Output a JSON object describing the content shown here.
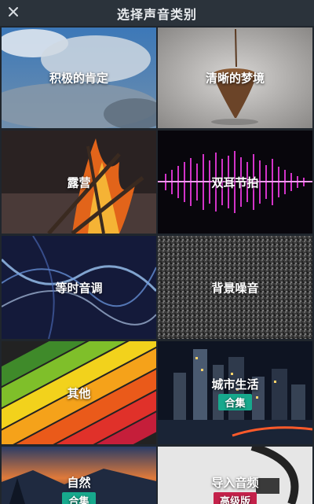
{
  "header": {
    "title": "选择声音类别",
    "close_icon": "close-icon"
  },
  "tiles": [
    {
      "label": "积极的肯定"
    },
    {
      "label": "清晰的梦境"
    },
    {
      "label": "露营"
    },
    {
      "label": "双耳节拍"
    },
    {
      "label": "等时音调"
    },
    {
      "label": "背景噪音"
    },
    {
      "label": "其他"
    },
    {
      "label": "城市生活",
      "badge": "合集"
    },
    {
      "label": "自然",
      "badge": "合集"
    },
    {
      "label": "导入音频",
      "badge": "高级版"
    }
  ]
}
